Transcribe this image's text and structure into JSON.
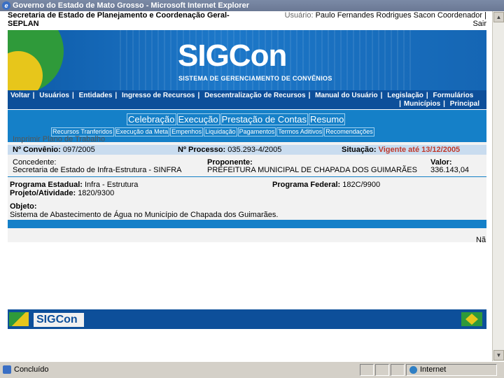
{
  "window": {
    "title": "Governo do Estado de Mato Grosso - Microsoft Internet Explorer"
  },
  "header": {
    "org_line1": "Secretaria de Estado de Planejamento e Coordenação Geral-",
    "org_line2": "SEPLAN",
    "user_label": "Usuário:",
    "user_value": "Paulo Fernandes Rodrigues Sacon Coordenador |",
    "logout": "Sair"
  },
  "banner": {
    "logo": "SIGCon",
    "subtitle": "SISTEMA DE GERENCIAMENTO DE CONVÊNIOS"
  },
  "nav": {
    "items": [
      "Voltar",
      "Usuários",
      "Entidades",
      "Ingresso de Recursos",
      "Descentralização de Recursos",
      "Manual do Usuário",
      "Legislação",
      "Formulários"
    ],
    "row2": [
      "Municípios",
      "Principal"
    ]
  },
  "tabs": [
    "Celebração",
    "Execução",
    "Prestação de Contas",
    "Resumo"
  ],
  "subtabs": [
    "Recursos Tranferidos",
    "Execução da Meta",
    "Empenhos",
    "Liquidação",
    "Pagamentos",
    "Termos Aditivos",
    "Recomendações"
  ],
  "plan_link": "Imprimir Plano de Trabalho",
  "summary": {
    "convenio_label": "Nº Convênio:",
    "convenio_value": "097/2005",
    "processo_label": "Nº Processo:",
    "processo_value": "035.293-4/2005",
    "situacao_label": "Situação:",
    "situacao_value": "Vigente até 13/12/2005",
    "situacao_color": "#c0392b"
  },
  "parties": {
    "concedente_label": "Concedente:",
    "concedente_value": "Secretaria de Estado de Infra-Estrutura - SINFRA",
    "proponente_label": "Proponente:",
    "proponente_value": "PREFEITURA MUNICIPAL DE CHAPADA DOS GUIMARÃES",
    "valor_label": "Valor:",
    "valor_value": "336.143,04"
  },
  "program": {
    "estadual_label": "Programa Estadual:",
    "estadual_value": "Infra - Estrutura",
    "federal_label": "Programa Federal:",
    "federal_value": "182C/9900",
    "projeto_label": "Projeto/Atividade:",
    "projeto_value": "1820/9300",
    "objeto_label": "Objeto:",
    "objeto_value": "Sistema de Abastecimento de Água no Município de Chapada dos Guimarães."
  },
  "misc_text": "Nã",
  "footer": {
    "logo": "SIGCon"
  },
  "status": {
    "left": "Concluído",
    "zone": "Internet"
  }
}
